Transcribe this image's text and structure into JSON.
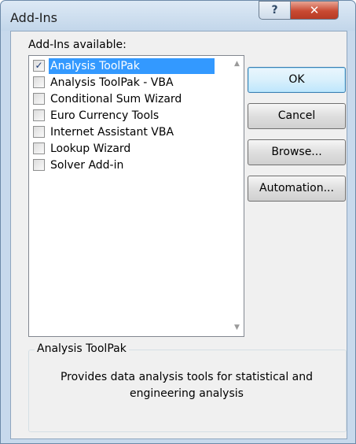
{
  "window": {
    "title": "Add-Ins",
    "help_glyph": "?",
    "close_glyph": "✕"
  },
  "list": {
    "label": "Add-Ins available:",
    "items": [
      {
        "label": "Analysis ToolPak",
        "checked": true,
        "selected": true
      },
      {
        "label": "Analysis ToolPak - VBA",
        "checked": false,
        "selected": false
      },
      {
        "label": "Conditional Sum Wizard",
        "checked": false,
        "selected": false
      },
      {
        "label": "Euro Currency Tools",
        "checked": false,
        "selected": false
      },
      {
        "label": "Internet Assistant VBA",
        "checked": false,
        "selected": false
      },
      {
        "label": "Lookup Wizard",
        "checked": false,
        "selected": false
      },
      {
        "label": "Solver Add-in",
        "checked": false,
        "selected": false
      }
    ],
    "scroll_up_glyph": "▲",
    "scroll_down_glyph": "▼"
  },
  "buttons": {
    "ok": "OK",
    "cancel": "Cancel",
    "browse": "Browse...",
    "automation": "Automation..."
  },
  "description": {
    "group_title": "Analysis ToolPak",
    "text": "Provides data analysis tools for statistical and engineering analysis"
  },
  "colors": {
    "selection": "#3399ff",
    "frame": "#c7d9ec",
    "close_button": "#c94a32"
  }
}
